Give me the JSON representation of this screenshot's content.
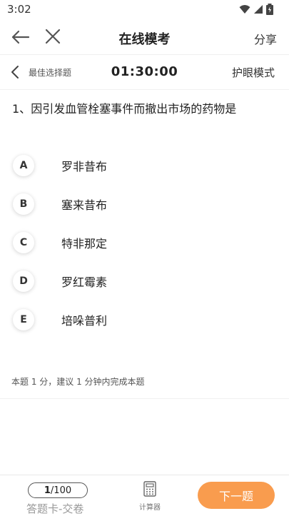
{
  "status_bar": {
    "time": "3:02"
  },
  "header": {
    "title": "在线模考",
    "share": "分享"
  },
  "subbar": {
    "mode": "最佳选择题",
    "timer": "01:30:00",
    "eye_mode": "护眼模式"
  },
  "question": {
    "number": "1、",
    "text": "因引发血管栓塞事件而撤出市场的药物是"
  },
  "options": [
    {
      "letter": "A",
      "text": "罗非昔布"
    },
    {
      "letter": "B",
      "text": "塞来昔布"
    },
    {
      "letter": "C",
      "text": "特非那定"
    },
    {
      "letter": "D",
      "text": "罗红霉素"
    },
    {
      "letter": "E",
      "text": "培哚普利"
    }
  ],
  "note": "本题 1 分，建议 1 分钟内完成本题",
  "bottom": {
    "current": "1",
    "total": "/100",
    "answer_card": "答题卡-交卷",
    "calculator": "计算器",
    "next": "下一题"
  },
  "colors": {
    "accent": "#f99c4e"
  }
}
